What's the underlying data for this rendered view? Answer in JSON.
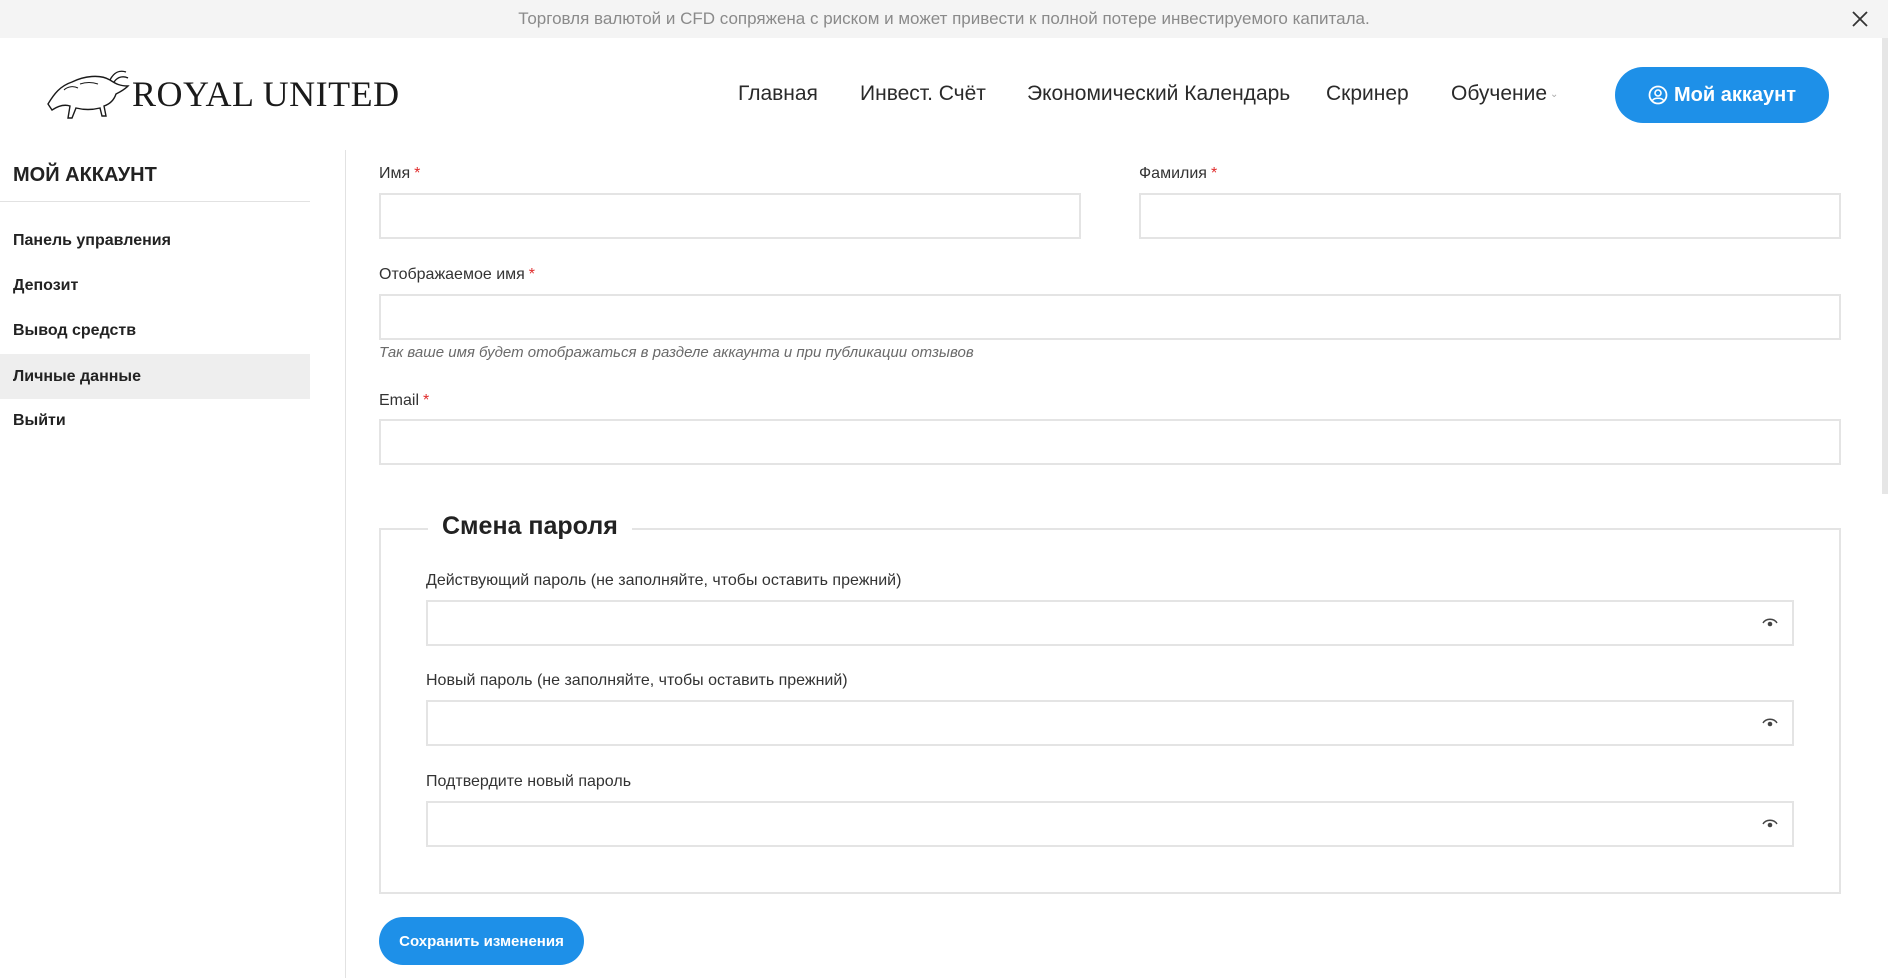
{
  "banner": {
    "text": "Торговля валютой и CFD сопряжена с риском и может привести к полной потере инвестируемого капитала.",
    "close_icon": "close-icon"
  },
  "header": {
    "logo_text": "ROYAL UNITED",
    "nav": [
      {
        "label": "Главная"
      },
      {
        "label": "Инвест. Счёт"
      },
      {
        "label": "Экономический Календарь"
      },
      {
        "label": "Скринер"
      },
      {
        "label": "Обучение",
        "icon": "chevron-down-icon"
      }
    ],
    "account_button": {
      "label": "Мой аккаунт",
      "icon": "user-circle-icon"
    },
    "accent_color": "#1e90e8"
  },
  "sidebar": {
    "title": "МОЙ АККАУНТ",
    "items": [
      {
        "label": "Панель управления"
      },
      {
        "label": "Депозит"
      },
      {
        "label": "Вывод средств"
      },
      {
        "label": "Личные данные",
        "active": true
      },
      {
        "label": "Выйти"
      }
    ]
  },
  "form": {
    "first_name": {
      "label": "Имя",
      "required": "*",
      "value": ""
    },
    "last_name": {
      "label": "Фамилия",
      "required": "*",
      "value": ""
    },
    "display_name": {
      "label": "Отображаемое имя",
      "required": "*",
      "value": "",
      "hint": "Так ваше имя будет отображаться в разделе аккаунта и при публикации отзывов"
    },
    "email": {
      "label": "Email",
      "required": "*",
      "value": ""
    },
    "password_section": {
      "title": "Смена пароля",
      "current": {
        "label": "Действующий пароль (не заполняйте, чтобы оставить прежний)",
        "icon": "eye-icon"
      },
      "new": {
        "label": "Новый пароль (не заполняйте, чтобы оставить прежний)",
        "icon": "eye-icon"
      },
      "confirm": {
        "label": "Подтвердите новый пароль",
        "icon": "eye-icon"
      }
    },
    "save_button": "Сохранить изменения"
  }
}
